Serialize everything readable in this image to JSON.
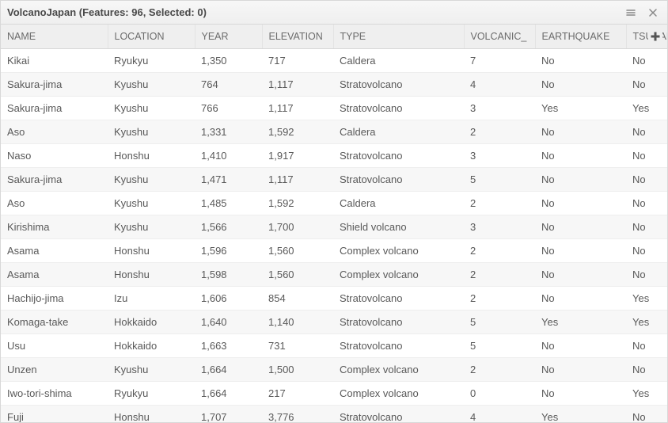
{
  "header": {
    "title": "VolcanoJapan (Features: 96, Selected: 0)"
  },
  "columns": [
    "NAME",
    "LOCATION",
    "YEAR",
    "ELEVATION",
    "TYPE",
    "VOLCANIC_",
    "EARTHQUAKE",
    "TSUNAMI"
  ],
  "rows": [
    {
      "name": "Kikai",
      "location": "Ryukyu",
      "year": "1,350",
      "elevation": "717",
      "type": "Caldera",
      "vei": "7",
      "earthquake": "No",
      "tsunami": "No"
    },
    {
      "name": "Sakura-jima",
      "location": "Kyushu",
      "year": "764",
      "elevation": "1,117",
      "type": "Stratovolcano",
      "vei": "4",
      "earthquake": "No",
      "tsunami": "No"
    },
    {
      "name": "Sakura-jima",
      "location": "Kyushu",
      "year": "766",
      "elevation": "1,117",
      "type": "Stratovolcano",
      "vei": "3",
      "earthquake": "Yes",
      "tsunami": "Yes"
    },
    {
      "name": "Aso",
      "location": "Kyushu",
      "year": "1,331",
      "elevation": "1,592",
      "type": "Caldera",
      "vei": "2",
      "earthquake": "No",
      "tsunami": "No"
    },
    {
      "name": "Naso",
      "location": "Honshu",
      "year": "1,410",
      "elevation": "1,917",
      "type": "Stratovolcano",
      "vei": "3",
      "earthquake": "No",
      "tsunami": "No"
    },
    {
      "name": "Sakura-jima",
      "location": "Kyushu",
      "year": "1,471",
      "elevation": "1,117",
      "type": "Stratovolcano",
      "vei": "5",
      "earthquake": "No",
      "tsunami": "No"
    },
    {
      "name": "Aso",
      "location": "Kyushu",
      "year": "1,485",
      "elevation": "1,592",
      "type": "Caldera",
      "vei": "2",
      "earthquake": "No",
      "tsunami": "No"
    },
    {
      "name": "Kirishima",
      "location": "Kyushu",
      "year": "1,566",
      "elevation": "1,700",
      "type": "Shield volcano",
      "vei": "3",
      "earthquake": "No",
      "tsunami": "No"
    },
    {
      "name": "Asama",
      "location": "Honshu",
      "year": "1,596",
      "elevation": "1,560",
      "type": "Complex volcano",
      "vei": "2",
      "earthquake": "No",
      "tsunami": "No"
    },
    {
      "name": "Asama",
      "location": "Honshu",
      "year": "1,598",
      "elevation": "1,560",
      "type": "Complex volcano",
      "vei": "2",
      "earthquake": "No",
      "tsunami": "No"
    },
    {
      "name": "Hachijo-jima",
      "location": "Izu",
      "year": "1,606",
      "elevation": "854",
      "type": "Stratovolcano",
      "vei": "2",
      "earthquake": "No",
      "tsunami": "Yes"
    },
    {
      "name": "Komaga-take",
      "location": "Hokkaido",
      "year": "1,640",
      "elevation": "1,140",
      "type": "Stratovolcano",
      "vei": "5",
      "earthquake": "Yes",
      "tsunami": "Yes"
    },
    {
      "name": "Usu",
      "location": "Hokkaido",
      "year": "1,663",
      "elevation": "731",
      "type": "Stratovolcano",
      "vei": "5",
      "earthquake": "No",
      "tsunami": "No"
    },
    {
      "name": "Unzen",
      "location": "Kyushu",
      "year": "1,664",
      "elevation": "1,500",
      "type": "Complex volcano",
      "vei": "2",
      "earthquake": "No",
      "tsunami": "No"
    },
    {
      "name": "Iwo-tori-shima",
      "location": "Ryukyu",
      "year": "1,664",
      "elevation": "217",
      "type": "Complex volcano",
      "vei": "0",
      "earthquake": "No",
      "tsunami": "Yes"
    },
    {
      "name": "Fuji",
      "location": "Honshu",
      "year": "1,707",
      "elevation": "3,776",
      "type": "Stratovolcano",
      "vei": "4",
      "earthquake": "Yes",
      "tsunami": "No"
    }
  ]
}
